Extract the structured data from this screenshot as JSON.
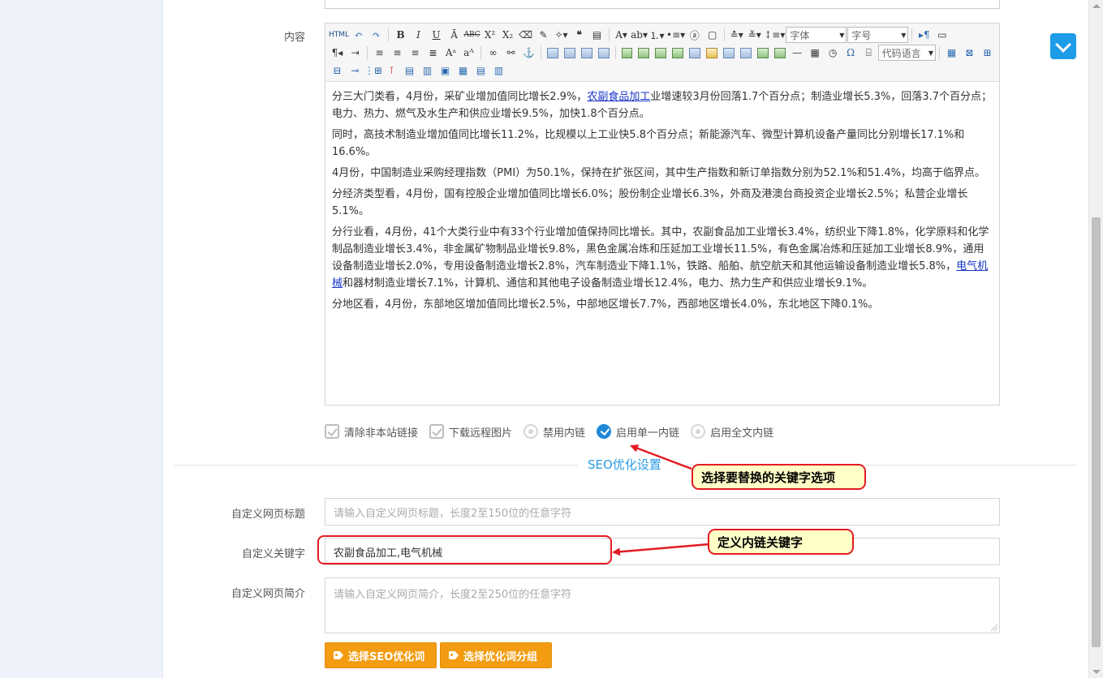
{
  "labels": {
    "content": "内容",
    "custom_title": "自定义网页标题",
    "custom_keywords": "自定义关键字",
    "custom_desc": "自定义网页简介"
  },
  "toolbar": {
    "html_btn": "HTML",
    "bold": "B",
    "italic": "I",
    "underline": "U",
    "font_family": "字体",
    "font_size": "字号",
    "code_lang": "代码语言"
  },
  "editor": {
    "p1_a": "分三大门类看，4月份，采矿业增加值同比增长2.9%，",
    "p1_link": "农副食品加工",
    "p1_b": "业增速较3月份回落1.7个百分点；制造业增长5.3%，回落3.7个百分点；电力、热力、燃气及水生产和供应业增长9.5%，加快1.8个百分点。",
    "p2": "同时，高技术制造业增加值同比增长11.2%，比规模以上工业快5.8个百分点；新能源汽车、微型计算机设备产量同比分别增长17.1%和16.6%。",
    "p3": "4月份，中国制造业采购经理指数（PMI）为50.1%，保持在扩张区间，其中生产指数和新订单指数分别为52.1%和51.4%，均高于临界点。",
    "p4": "分经济类型看，4月份，国有控股企业增加值同比增长6.0%；股份制企业增长6.3%，外商及港澳台商投资企业增长2.5%；私营企业增长5.1%。",
    "p5_a": "分行业看，4月份，41个大类行业中有33个行业增加值保持同比增长。其中，农副食品加工业增长3.4%，纺织业下降1.8%，化学原料和化学制品制造业增长3.4%，非金属矿物制品业增长9.8%，黑色金属冶炼和压延加工业增长11.5%，有色金属冶炼和压延加工业增长8.9%，通用设备制造业增长2.0%，专用设备制造业增长2.8%，汽车制造业下降1.1%，铁路、船舶、航空航天和其他运输设备制造业增长5.8%，",
    "p5_link": "电气机械",
    "p5_b": "和器材制造业增长7.1%，计算机、通信和其他电子设备制造业增长12.4%，电力、热力生产和供应业增长9.1%。",
    "p6": "分地区看，4月份，东部地区增加值同比增长2.5%，中部地区增长7.7%，西部地区增长4.0%，东北地区下降0.1%。"
  },
  "options": {
    "clear_links": "清除非本站链接",
    "download_images": "下载远程图片",
    "disable_inner_link": "禁用内链",
    "single_inner_link": "启用单一内链",
    "full_inner_link": "启用全文内链",
    "selected": "single_inner_link"
  },
  "seo": {
    "section_title": "SEO优化设置",
    "title_placeholder": "请输入自定义网页标题，长度2至150位的任意字符",
    "keywords_value": "农副食品加工,电气机械",
    "desc_placeholder": "请输入自定义网页简介，长度2至250位的任意字符",
    "btn_select_words": "选择SEO优化词",
    "btn_select_group": "选择优化词分组"
  },
  "callouts": {
    "select_option": "选择要替换的关键字选项",
    "define_keywords": "定义内链关键字"
  },
  "colors": {
    "accent": "#1e88d9",
    "button": "#f39c12",
    "callout_border": "#e31b23",
    "callout_bg": "#ffffc8",
    "link": "#1a35c8"
  }
}
